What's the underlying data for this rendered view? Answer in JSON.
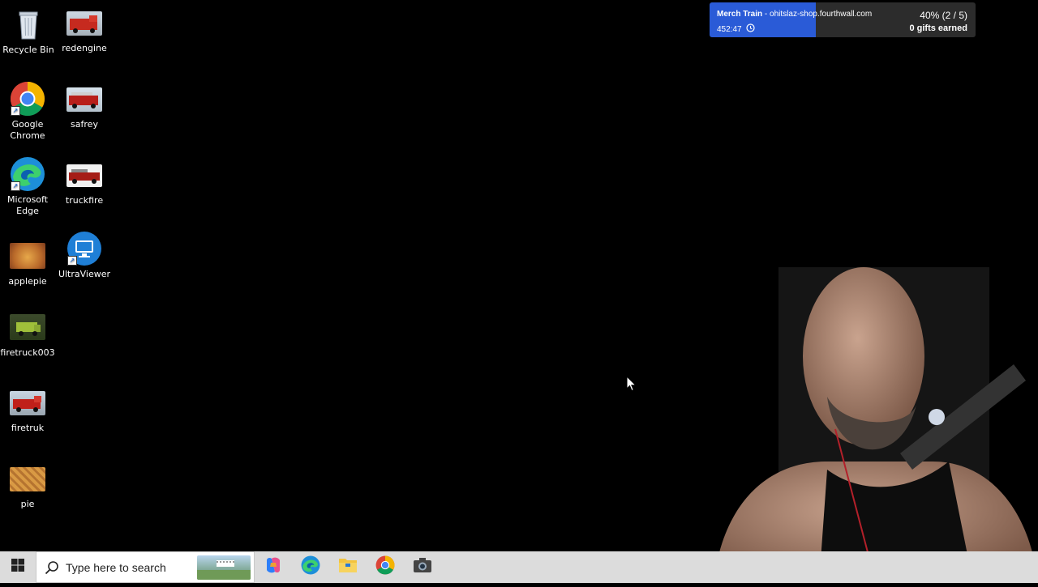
{
  "desktop": {
    "icons": [
      {
        "label": "Recycle Bin",
        "icon": "recycle-bin-icon"
      },
      {
        "label": "redengine",
        "icon": "image-thumbnail"
      },
      {
        "label": "Google Chrome",
        "icon": "chrome-icon"
      },
      {
        "label": "safrey",
        "icon": "image-thumbnail"
      },
      {
        "label": "Microsoft Edge",
        "icon": "edge-icon"
      },
      {
        "label": "truckfire",
        "icon": "image-thumbnail"
      },
      {
        "label": "applepie",
        "icon": "image-thumbnail"
      },
      {
        "label": "UltraViewer",
        "icon": "ultraviewer-icon"
      },
      {
        "label": "firetruck003",
        "icon": "image-thumbnail"
      },
      {
        "label": "firetruk",
        "icon": "image-thumbnail"
      },
      {
        "label": "pie",
        "icon": "image-thumbnail"
      }
    ]
  },
  "merch_overlay": {
    "title": "Merch Train",
    "separator": " - ",
    "site": "ohitslaz-shop.fourthwall.com",
    "timer": "452:47",
    "progress_text": "40% (2 / 5)",
    "progress_fraction": 0.4,
    "gifts_text": "0 gifts earned",
    "fill_color": "#2a5bd7"
  },
  "taskbar": {
    "search_placeholder": "Type here to search",
    "apps": [
      "copilot-icon",
      "edge-icon",
      "file-explorer-icon",
      "chrome-icon",
      "camera-icon"
    ]
  }
}
